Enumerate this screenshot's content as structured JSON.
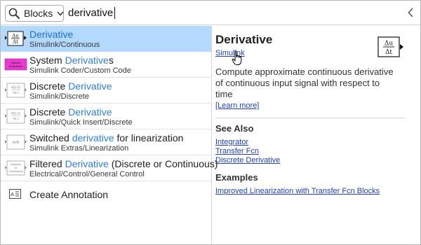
{
  "search": {
    "scope_label": "Blocks",
    "query": "derivative"
  },
  "results": [
    {
      "pre": "",
      "match": "Derivative",
      "post": "",
      "path": "Simulink/Continuous",
      "selected": true
    },
    {
      "pre": "System ",
      "match": "Derivative",
      "post": "s",
      "path": "Simulink Coder/Custom Code",
      "selected": false
    },
    {
      "pre": "Discrete ",
      "match": "Derivative",
      "post": "",
      "path": "Simulink/Discrete",
      "selected": false
    },
    {
      "pre": "Discrete ",
      "match": "Derivative",
      "post": "",
      "path": "Simulink/Quick Insert/Discrete",
      "selected": false
    },
    {
      "pre": "Switched ",
      "match": "derivative",
      "post": " for linearization",
      "path": "Simulink Extras/Linearization",
      "selected": false
    },
    {
      "pre": "Filtered ",
      "match": "Derivative",
      "post": " (Discrete or Continuous)",
      "path": "Electrical/Control/General Control",
      "selected": false
    }
  ],
  "create_annotation": "Create Annotation",
  "thumb_labels": {
    "system_derivatives": [
      "System",
      "Derivatives"
    ]
  },
  "detail": {
    "title": "Derivative",
    "library_link": "Simulink",
    "block_icon_top": "Δu",
    "block_icon_bottom": "Δt",
    "description": "Compute approximate continuous derivative of continuous input signal with respect to time",
    "learn_more": "[Learn more]",
    "see_also_heading": "See Also",
    "see_also": [
      "Integrator",
      "Transfer Fcn",
      "Discrete Derivative"
    ],
    "examples_heading": "Examples",
    "examples": [
      "Improved Linearization with Transfer Fcn Blocks"
    ]
  },
  "colors": {
    "selected_bg": "#b3d9ff",
    "match_text": "#2f7fd8",
    "link": "#1f3fbf",
    "system_derivatives_thumb": "#e83ad0"
  },
  "icons": {
    "scope_search": "search-icon",
    "scope_dropdown": "chevron-down-icon",
    "collapse": "chevron-left-icon",
    "annotation": "annotation-icon",
    "cursor": "hand-pointer-icon"
  }
}
